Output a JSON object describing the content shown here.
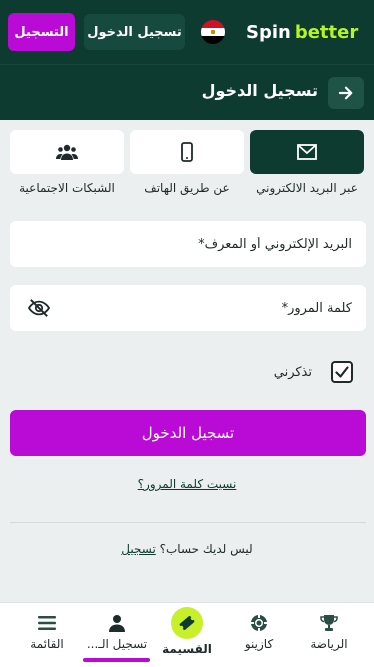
{
  "header": {
    "logo_spin": "Spin",
    "logo_better": "better",
    "login_label": "تسجيل الدخول",
    "register_label": "التسجيل"
  },
  "page": {
    "title": "تسجيل الدخول"
  },
  "tabs": [
    {
      "label": "عبر البريد الالكتروني",
      "icon": "envelope-icon",
      "active": true
    },
    {
      "label": "عن طريق الهاتف",
      "icon": "phone-icon",
      "active": false
    },
    {
      "label": "الشبكات الاجتماعية",
      "icon": "users-icon",
      "active": false
    }
  ],
  "form": {
    "email_placeholder": "البريد الإلكتروني أو المعرف*",
    "password_placeholder": "كلمة المرور*",
    "remember_label": "تذكرني",
    "remember_checked": true,
    "submit_label": "تسجيل الدخول",
    "forgot_label": "نسيت كلمة المرور؟",
    "no_account_text": "ليس لديك حساب؟",
    "register_link": "تسجيل"
  },
  "bottom_nav": {
    "sports": "الرياضة",
    "casino": "كازينو",
    "coupon": "القسيمة",
    "login": "تسجيل الـ...",
    "menu": "القائمة"
  },
  "colors": {
    "brand_dark": "#0d3b30",
    "accent_purple": "#b90ad6",
    "accent_lime": "#b3f526"
  }
}
